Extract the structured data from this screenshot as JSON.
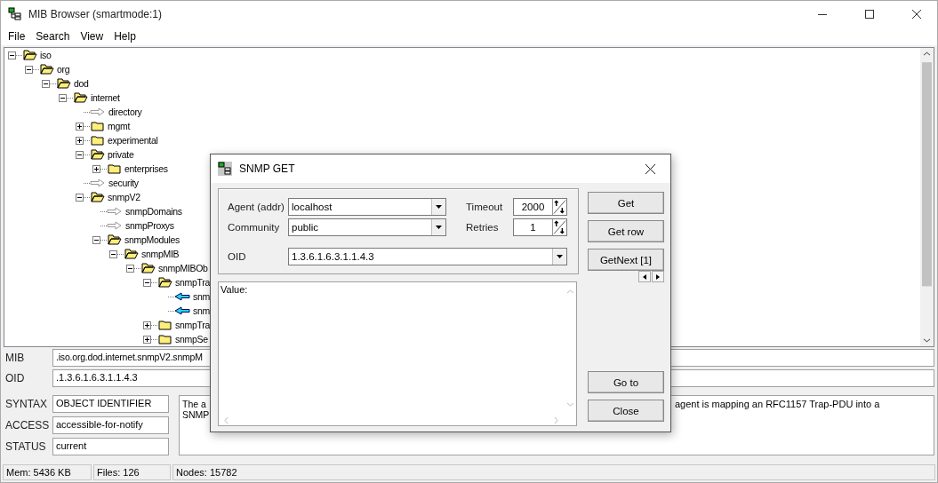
{
  "window": {
    "title": "MIB Browser (smartmode:1)"
  },
  "menu": [
    "File",
    "Search",
    "View",
    "Help"
  ],
  "tree": [
    {
      "label": "iso",
      "kind": "folder",
      "expanded": true,
      "children": [
        {
          "label": "org",
          "kind": "folder",
          "expanded": true,
          "children": [
            {
              "label": "dod",
              "kind": "folder",
              "expanded": true,
              "children": [
                {
                  "label": "internet",
                  "kind": "folder",
                  "expanded": true,
                  "children": [
                    {
                      "label": "directory",
                      "kind": "leaf"
                    },
                    {
                      "label": "mgmt",
                      "kind": "folder",
                      "expanded": false
                    },
                    {
                      "label": "experimental",
                      "kind": "folder",
                      "expanded": false
                    },
                    {
                      "label": "private",
                      "kind": "folder",
                      "expanded": true,
                      "children": [
                        {
                          "label": "enterprises",
                          "kind": "folder",
                          "expanded": false
                        }
                      ]
                    },
                    {
                      "label": "security",
                      "kind": "leaf"
                    },
                    {
                      "label": "snmpV2",
                      "kind": "folder",
                      "expanded": true,
                      "children": [
                        {
                          "label": "snmpDomains",
                          "kind": "leaf"
                        },
                        {
                          "label": "snmpProxys",
                          "kind": "leaf"
                        },
                        {
                          "label": "snmpModules",
                          "kind": "folder",
                          "expanded": true,
                          "children": [
                            {
                              "label": "snmpMIB",
                              "kind": "folder",
                              "expanded": true,
                              "children": [
                                {
                                  "label": "snmpMIBOb",
                                  "kind": "folder",
                                  "expanded": true,
                                  "children": [
                                    {
                                      "label": "snmpTra",
                                      "kind": "folder",
                                      "expanded": true,
                                      "children": [
                                        {
                                          "label": "snm",
                                          "kind": "notification"
                                        },
                                        {
                                          "label": "snm",
                                          "kind": "notification"
                                        }
                                      ]
                                    },
                                    {
                                      "label": "snmpTra",
                                      "kind": "folder",
                                      "expanded": false
                                    },
                                    {
                                      "label": "snmpSe",
                                      "kind": "folder",
                                      "expanded": false
                                    }
                                  ]
                                }
                              ]
                            }
                          ]
                        }
                      ]
                    }
                  ]
                }
              ]
            }
          ]
        }
      ]
    }
  ],
  "details": {
    "mib_label": "MIB",
    "mib_value": ".iso.org.dod.internet.snmpV2.snmpM",
    "oid_label": "OID",
    "oid_value": ".1.3.6.1.6.3.1.1.4.3",
    "fields": [
      {
        "label": "SYNTAX",
        "value": "OBJECT IDENTIFIER"
      },
      {
        "label": "ACCESS",
        "value": "accessible-for-notify"
      },
      {
        "label": "STATUS",
        "value": "current"
      }
    ],
    "description_left": [
      "The a",
      "SNMP"
    ],
    "description_right": "agent is mapping an RFC1157 Trap-PDU into a"
  },
  "status_bar": [
    "Mem: 5436 KB",
    "Files: 126",
    "Nodes: 15782"
  ],
  "dialog": {
    "title": "SNMP GET",
    "agent_label": "Agent (addr)",
    "agent": "localhost",
    "community_label": "Community",
    "community": "public",
    "timeout_label": "Timeout",
    "timeout": "2000",
    "retries_label": "Retries",
    "retries": "1",
    "oid_label": "OID",
    "oid": "1.3.6.1.6.3.1.1.4.3",
    "value_label": "Value:",
    "buttons": [
      "Get",
      "Get row",
      "GetNext [1]"
    ],
    "bottom_buttons": [
      "Go to",
      "Close"
    ]
  }
}
